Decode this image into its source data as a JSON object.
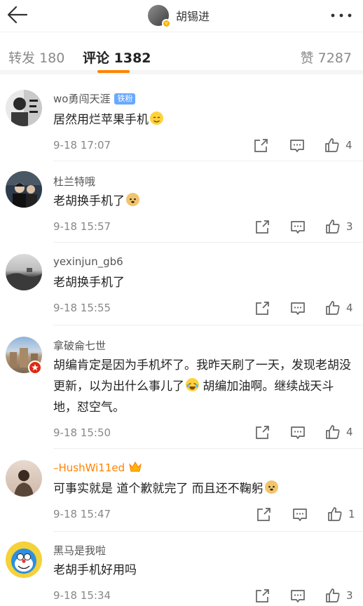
{
  "header": {
    "title": "胡锡进",
    "verified_badge": "v"
  },
  "tabs": [
    {
      "label": "转发",
      "count": "180"
    },
    {
      "label": "评论",
      "count": "1382"
    },
    {
      "label": "赞",
      "count": "7287"
    }
  ],
  "colors": {
    "accent": "#ff8200",
    "fan_badge": "#6aa8ff",
    "vip_name": "#ff8200"
  },
  "comments": [
    {
      "user": "wo勇闯天涯",
      "badge": "铁粉",
      "text": "居然用烂苹果手机",
      "emoji": "smile-emoji",
      "time": "9-18 17:07",
      "likes": "4"
    },
    {
      "user": "杜兰特哦",
      "text": "老胡换手机了",
      "emoji": "doge-emoji",
      "time": "9-18 15:57",
      "likes": "3"
    },
    {
      "user": "yexinjun_gb6",
      "text": "老胡换手机了",
      "time": "9-18 15:55",
      "likes": "4"
    },
    {
      "user": "拿破侖七世",
      "text": "胡编肯定是因为手机坏了。我昨天刷了一天，发现老胡没更新，以为出什么事儿了",
      "text_after": " 胡编加油啊。继续战天斗地，怼空气。",
      "emoji": "laugh-cry-emoji",
      "time": "9-18 15:50",
      "likes": "4"
    },
    {
      "user": "–HushWi11ed",
      "text": "可事实就是 道个歉就完了 而且还不鞠躬",
      "emoji": "doge-emoji",
      "time": "9-18 15:47",
      "likes": "1"
    },
    {
      "user": "黑马是我啦",
      "text": "老胡手机好用吗",
      "time": "9-18 15:34",
      "likes": "3"
    }
  ]
}
